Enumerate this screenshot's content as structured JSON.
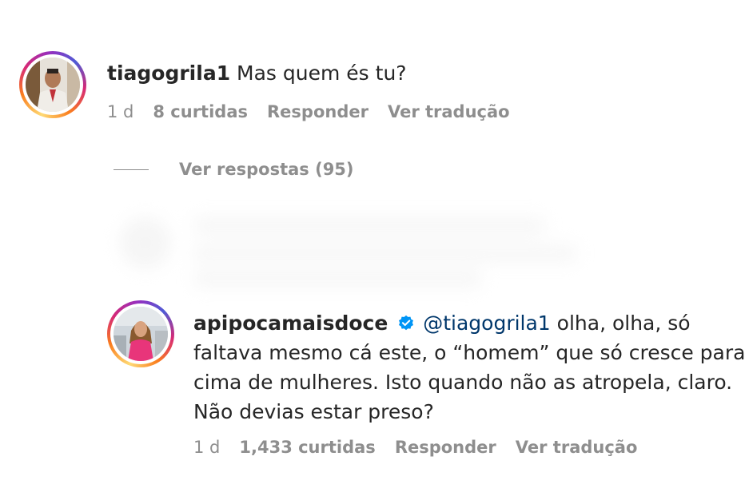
{
  "comments": [
    {
      "username": "tiagogrila1",
      "verified": false,
      "mention": "",
      "text_lines": [
        "Mas quem és tu?"
      ],
      "time": "1 d",
      "likes": "8 curtidas",
      "reply_label": "Responder",
      "translate_label": "Ver tradução"
    },
    {
      "username": "apipocamaisdoce",
      "verified": true,
      "mention": "@tiagogrila1",
      "text_lines": [
        " olha, olha, só",
        "faltava mesmo cá este, o “homem” que só cresce para",
        "cima de mulheres. Isto quando não as atropela, claro.",
        "Não devias estar preso?"
      ],
      "time": "1 d",
      "likes": "1,433 curtidas",
      "reply_label": "Responder",
      "translate_label": "Ver tradução"
    }
  ],
  "view_replies_label": "Ver respostas (95)",
  "colors": {
    "text": "#262626",
    "meta": "#8e8e8e",
    "mention": "#00376b",
    "verified": "#0095f6"
  },
  "icons": {
    "verified": "verified-badge-icon"
  }
}
